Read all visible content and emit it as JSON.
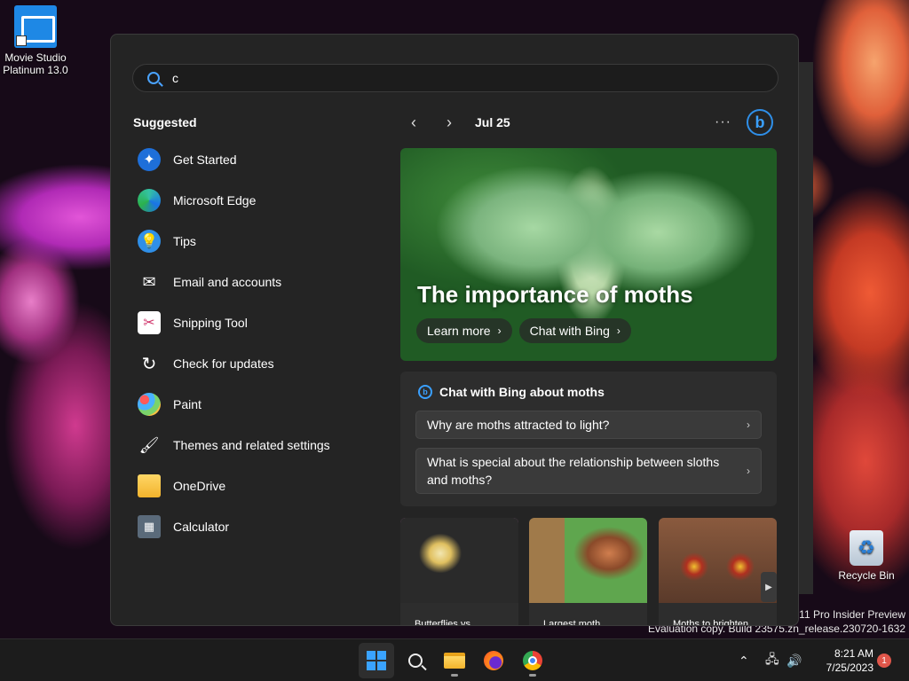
{
  "desktop": {
    "movie_studio": {
      "line1": "Movie Studio",
      "line2": "Platinum 13.0"
    },
    "recycle_bin": {
      "label": "Recycle Bin"
    },
    "watermark": {
      "line1": "s 11 Pro Insider Preview",
      "line2": "Evaluation copy. Build 23575.zn_release.230720-1632"
    }
  },
  "start_menu": {
    "search": {
      "value": "c",
      "placeholder": ""
    },
    "suggested": {
      "title": "Suggested",
      "items": [
        {
          "label": "Get Started",
          "icon": "get-started-icon"
        },
        {
          "label": "Microsoft Edge",
          "icon": "edge-icon"
        },
        {
          "label": "Tips",
          "icon": "tips-icon"
        },
        {
          "label": "Email and accounts",
          "icon": "mail-icon"
        },
        {
          "label": "Snipping Tool",
          "icon": "snipping-tool-icon"
        },
        {
          "label": "Check for updates",
          "icon": "refresh-icon"
        },
        {
          "label": "Paint",
          "icon": "paint-icon"
        },
        {
          "label": "Themes and related settings",
          "icon": "brush-icon"
        },
        {
          "label": "OneDrive",
          "icon": "onedrive-icon"
        },
        {
          "label": "Calculator",
          "icon": "calculator-icon"
        }
      ]
    },
    "nav": {
      "date": "Jul 25",
      "more": "···",
      "bing_logo": "b"
    },
    "hero": {
      "title": "The importance of moths",
      "learn_more": "Learn more",
      "chat_with_bing": "Chat with Bing"
    },
    "chat_card": {
      "title": "Chat with Bing about moths",
      "questions": [
        "Why are moths attracted to light?",
        "What is special about the relationship between sloths and moths?"
      ]
    },
    "tiles": [
      {
        "caption": "Butterflies vs."
      },
      {
        "caption": "Largest moth"
      },
      {
        "caption": "Moths to brighten"
      }
    ]
  },
  "taskbar": {
    "clock": {
      "time": "8:21 AM",
      "date": "7/25/2023"
    },
    "notification_count": "1"
  },
  "colors": {
    "accent": "#3aa3ff",
    "menu_bg": "#242424",
    "taskbar_bg": "#1c1c1c",
    "badge": "#e0564a"
  }
}
